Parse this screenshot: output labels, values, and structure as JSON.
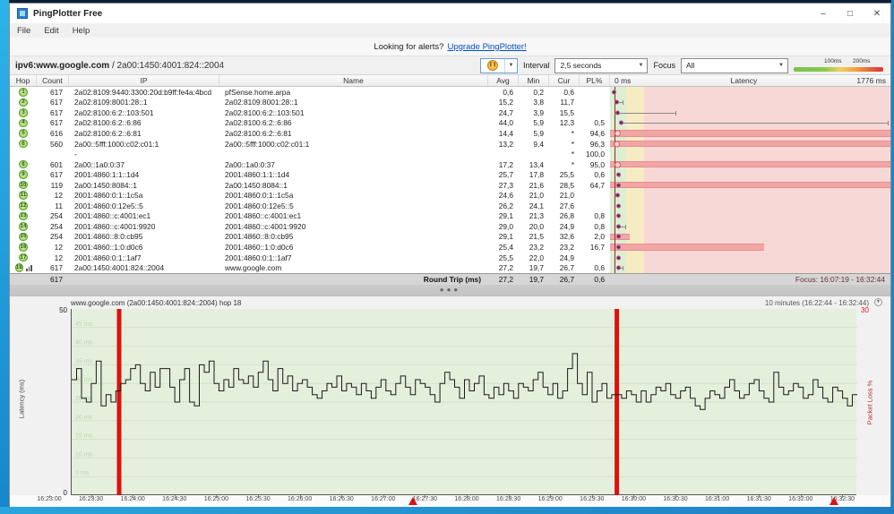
{
  "window": {
    "title": "PingPlotter Free",
    "menu": [
      "File",
      "Edit",
      "Help"
    ],
    "controls": {
      "minimize": "–",
      "maximize": "□",
      "close": "✕"
    }
  },
  "alert": {
    "prefix": "Looking for alerts?",
    "link": "Upgrade PingPlotter!"
  },
  "toolbar": {
    "target_host": "ipv6:www.google.com",
    "target_sep": " / ",
    "target_ip": "2a00:1450:4001:824::2004",
    "interval_label": "Interval",
    "interval_value": "2,5 seconds",
    "focus_label": "Focus",
    "focus_value": "All",
    "legend": {
      "label_100": "100ms",
      "label_200": "200ms",
      "color_green": "#79c24d",
      "color_yellow": "#f0d060",
      "color_red": "#dd3b2d"
    }
  },
  "table": {
    "headers": {
      "hop": "Hop",
      "count": "Count",
      "ip": "IP",
      "name": "Name",
      "avg": "Avg",
      "min": "Min",
      "cur": "Cur",
      "pl": "PL%",
      "lat_min": "0 ms",
      "lat_title": "Latency",
      "lat_max": "1776 ms"
    },
    "rows": [
      {
        "hop": "1",
        "count": "617",
        "ip": "2a02:8109:9440:3300:20d:b9ff:fe4a:4bcd",
        "name": "pfSense.home.arpa",
        "avg": "0,6",
        "min": "0,2",
        "cur": "0,6",
        "pl": "",
        "marker": "dot",
        "whisker": 1,
        "bar": 0,
        "icon": false
      },
      {
        "hop": "2",
        "count": "617",
        "ip": "2a02:8109:8001:28::1",
        "name": "2a02:8109:8001:28::1",
        "avg": "15,2",
        "min": "3,8",
        "cur": "11,7",
        "pl": "",
        "marker": "dot",
        "whisker": 4,
        "bar": 0,
        "icon": false
      },
      {
        "hop": "3",
        "count": "617",
        "ip": "2a02:8100:6:2::103:501",
        "name": "2a02:8100:6:2::103:501",
        "avg": "24,7",
        "min": "3,9",
        "cur": "15,5",
        "pl": "",
        "marker": "dot",
        "whisker": 23,
        "bar": 0,
        "icon": false
      },
      {
        "hop": "4",
        "count": "617",
        "ip": "2a02:8100:6:2::6:86",
        "name": "2a02:8100:6:2::6:86",
        "avg": "44,0",
        "min": "5,9",
        "cur": "12,3",
        "pl": "0,5",
        "marker": "dot",
        "whisker": 98,
        "bar": 0,
        "icon": false
      },
      {
        "hop": "5",
        "count": "616",
        "ip": "2a02:8100:6:2::6:81",
        "name": "2a02:8100:6:2::6:81",
        "avg": "14,4",
        "min": "5,9",
        "cur": "*",
        "pl": "94,6",
        "marker": "ring",
        "whisker": 0,
        "bar": 100,
        "icon": false
      },
      {
        "hop": "6",
        "count": "560",
        "ip": "2a00::5fff:1000:c02:c01:1",
        "name": "2a00::5fff:1000:c02:c01:1",
        "avg": "13,2",
        "min": "9,4",
        "cur": "*",
        "pl": "96,3",
        "marker": "ring",
        "whisker": 0,
        "bar": 100,
        "icon": false
      },
      {
        "hop": "",
        "count": "",
        "ip": "-",
        "name": "",
        "avg": "",
        "min": "",
        "cur": "*",
        "pl": "100,0",
        "marker": "",
        "whisker": 0,
        "bar": 0,
        "icon": false
      },
      {
        "hop": "8",
        "count": "601",
        "ip": "2a00::1a0:0:37",
        "name": "2a00::1a0:0:37",
        "avg": "17,2",
        "min": "13,4",
        "cur": "*",
        "pl": "95,0",
        "marker": "ring",
        "whisker": 0,
        "bar": 100,
        "icon": false
      },
      {
        "hop": "9",
        "count": "617",
        "ip": "2001:4860:1:1::1d4",
        "name": "2001:4860:1:1::1d4",
        "avg": "25,7",
        "min": "17,8",
        "cur": "25,5",
        "pl": "0,6",
        "marker": "dot",
        "whisker": 2,
        "bar": 0,
        "icon": false
      },
      {
        "hop": "10",
        "count": "119",
        "ip": "2a00:1450:8084::1",
        "name": "2a00:1450:8084::1",
        "avg": "27,3",
        "min": "21,6",
        "cur": "28,5",
        "pl": "64,7",
        "marker": "dot",
        "whisker": 0,
        "bar": 100,
        "icon": false
      },
      {
        "hop": "11",
        "count": "12",
        "ip": "2001:4860:0:1::1c5a",
        "name": "2001:4860:0:1::1c5a",
        "avg": "24,6",
        "min": "21,0",
        "cur": "21,0",
        "pl": "",
        "marker": "dot",
        "whisker": 0,
        "bar": 0,
        "icon": false
      },
      {
        "hop": "12",
        "count": "11",
        "ip": "2001:4860:0:12e5::5",
        "name": "2001:4860:0:12e5::5",
        "avg": "26,2",
        "min": "24,1",
        "cur": "27,6",
        "pl": "",
        "marker": "dot",
        "whisker": 0,
        "bar": 0,
        "icon": false
      },
      {
        "hop": "13",
        "count": "254",
        "ip": "2001:4860::c:4001:ec1",
        "name": "2001:4860::c:4001:ec1",
        "avg": "29,1",
        "min": "21,3",
        "cur": "26,8",
        "pl": "0,8",
        "marker": "dot",
        "whisker": 0,
        "bar": 0,
        "icon": false
      },
      {
        "hop": "14",
        "count": "254",
        "ip": "2001:4860::c:4001:9920",
        "name": "2001:4860::c:4001:9920",
        "avg": "29,0",
        "min": "20,0",
        "cur": "24,9",
        "pl": "0,8",
        "marker": "dot",
        "whisker": 5,
        "bar": 0,
        "icon": false
      },
      {
        "hop": "15",
        "count": "254",
        "ip": "2001:4860::8:0:cb95",
        "name": "2001:4860::8:0:cb95",
        "avg": "29,1",
        "min": "21,5",
        "cur": "32,6",
        "pl": "2,0",
        "marker": "dot",
        "whisker": 0,
        "bar": 7,
        "icon": false
      },
      {
        "hop": "16",
        "count": "12",
        "ip": "2001:4860::1:0:d0c6",
        "name": "2001:4860::1:0:d0c6",
        "avg": "25,4",
        "min": "23,2",
        "cur": "23,2",
        "pl": "16,7",
        "marker": "dot",
        "whisker": 0,
        "bar": 55,
        "icon": false
      },
      {
        "hop": "17",
        "count": "12",
        "ip": "2001:4860:0:1::1af7",
        "name": "2001:4860:0:1::1af7",
        "avg": "25,5",
        "min": "22,0",
        "cur": "24,9",
        "pl": "",
        "marker": "dot",
        "whisker": 0,
        "bar": 0,
        "icon": false
      },
      {
        "hop": "18",
        "count": "617",
        "ip": "2a00:1450:4001:824::2004",
        "name": "www.google.com",
        "avg": "27,2",
        "min": "19,7",
        "cur": "26,7",
        "pl": "0,6",
        "marker": "dot",
        "whisker": 4,
        "bar": 0,
        "icon": true
      }
    ],
    "round_trip": {
      "count": "617",
      "label": "Round Trip (ms)",
      "avg": "27,2",
      "min": "19,7",
      "cur": "26,7",
      "pl": "0,6",
      "focus": "Focus: 16:07:19 - 16:32:44"
    }
  },
  "timeline": {
    "range_label": "10 minutes (16:22:44 - 16:32:44)",
    "title": "www.google.com (2a00:1450:4001:824::2004) hop 18",
    "y_top": "50",
    "y_bottom": "0",
    "y_axis_label": "Latency (ms)",
    "right_top": "30",
    "right_label": "Packet Loss %",
    "grid_labels": [
      "45 ms",
      "40 ms",
      "35 ms",
      "30 ms",
      "25 ms",
      "20 ms",
      "15 ms",
      "10 ms",
      "5 ms"
    ],
    "x_ticks": [
      "16:23:00",
      "16:23:30",
      "16:24:00",
      "16:24:30",
      "16:25:00",
      "16:25:30",
      "16:26:00",
      "16:26:30",
      "16:27:00",
      "16:27:30",
      "16:28:00",
      "16:28:30",
      "16:29:00",
      "16:29:30",
      "16:30:00",
      "16:30:30",
      "16:31:00",
      "16:31:30",
      "16:32:00",
      "16:32:30"
    ],
    "chart_data": {
      "type": "line",
      "ylabel": "Latency (ms)",
      "ylim": [
        0,
        50
      ],
      "values": [
        31,
        34,
        26,
        25,
        30,
        36,
        24,
        27,
        25,
        28,
        30,
        31,
        34,
        35,
        30,
        28,
        33,
        29,
        34,
        34,
        29,
        25,
        31,
        34,
        25,
        24,
        35,
        33,
        36,
        30,
        28,
        31,
        29,
        34,
        31,
        30,
        32,
        29,
        33,
        36,
        31,
        28,
        34,
        30,
        32,
        28,
        30,
        31,
        29,
        27,
        26,
        28,
        30,
        29,
        32,
        28,
        30,
        29,
        27,
        30,
        28,
        26,
        29,
        31,
        28,
        27,
        30,
        32,
        29,
        27,
        31,
        30,
        29,
        27,
        25,
        30,
        33,
        31,
        29,
        26,
        31,
        28,
        30,
        32,
        27,
        26,
        29,
        27,
        30,
        28,
        26,
        30,
        29,
        28,
        31,
        33,
        29,
        27,
        30,
        26,
        28,
        34,
        38,
        30,
        27,
        33,
        25,
        28,
        30,
        26,
        27,
        27,
        26,
        28,
        27,
        25,
        28,
        25,
        27,
        29,
        28,
        30,
        27,
        26,
        28,
        29,
        26,
        24,
        23,
        26,
        28,
        27,
        26,
        29,
        31,
        28,
        26,
        27,
        30,
        31,
        28,
        26,
        25,
        33,
        29,
        27,
        28,
        30,
        29,
        26,
        27,
        31,
        29,
        26,
        25,
        29,
        28,
        26,
        24,
        27
      ]
    },
    "red_bars": [
      0.0604,
      0.694
    ],
    "triangles": [
      0.4356,
      0.9718
    ]
  }
}
